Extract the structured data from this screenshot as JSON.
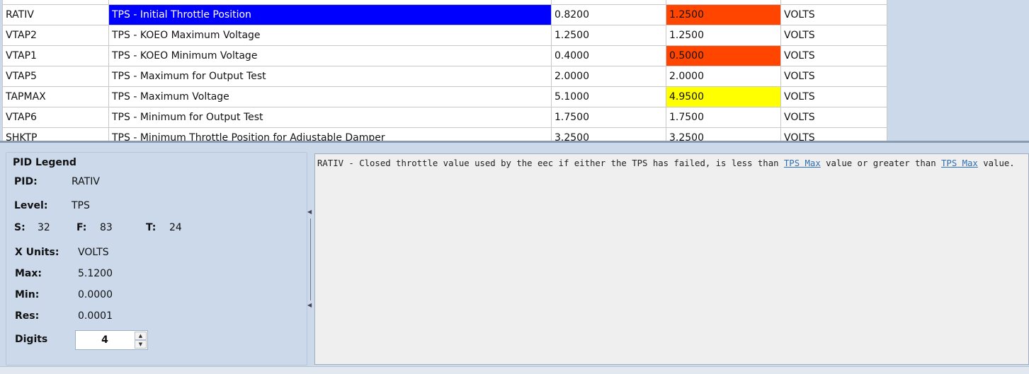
{
  "grid": {
    "rows": [
      {
        "pid": "RATIV",
        "desc": "TPS - Initial Throttle Position",
        "v1": "0.8200",
        "v2": "1.2500",
        "units": "VOLTS",
        "highlight": "orange",
        "selected": true
      },
      {
        "pid": "VTAP2",
        "desc": "TPS - KOEO Maximum Voltage",
        "v1": "1.2500",
        "v2": "1.2500",
        "units": "VOLTS",
        "highlight": "none",
        "selected": false
      },
      {
        "pid": "VTAP1",
        "desc": "TPS - KOEO Minimum Voltage",
        "v1": "0.4000",
        "v2": "0.5000",
        "units": "VOLTS",
        "highlight": "orange",
        "selected": false
      },
      {
        "pid": "VTAP5",
        "desc": "TPS - Maximum for Output Test",
        "v1": "2.0000",
        "v2": "2.0000",
        "units": "VOLTS",
        "highlight": "none",
        "selected": false
      },
      {
        "pid": "TAPMAX",
        "desc": "TPS - Maximum Voltage",
        "v1": "5.1000",
        "v2": "4.9500",
        "units": "VOLTS",
        "highlight": "yellow",
        "selected": false
      },
      {
        "pid": "VTAP6",
        "desc": "TPS - Minimum for Output Test",
        "v1": "1.7500",
        "v2": "1.7500",
        "units": "VOLTS",
        "highlight": "none",
        "selected": false
      },
      {
        "pid": "SHKTP",
        "desc": "TPS - Minimum Throttle Position for Adjustable Damper",
        "v1": "3.2500",
        "v2": "3.2500",
        "units": "VOLTS",
        "highlight": "none",
        "selected": false
      }
    ],
    "colors": {
      "selected": "#0000ff",
      "orange": "#ff4500",
      "yellow": "#ffff00"
    }
  },
  "legend": {
    "title": "PID Legend",
    "pid_label": "PID:",
    "pid_value": "RATIV",
    "level_label": "Level:",
    "level_value": "TPS",
    "s_label": "S:",
    "s_value": "32",
    "f_label": "F:",
    "f_value": "83",
    "t_label": "T:",
    "t_value": "24",
    "xunits_label": "X Units:",
    "xunits_value": "VOLTS",
    "max_label": "Max:",
    "max_value": "5.1200",
    "min_label": "Min:",
    "min_value": "0.0000",
    "res_label": "Res:",
    "res_value": "0.0001",
    "digits_label": "Digits",
    "digits_value": "4"
  },
  "description": {
    "text1": "RATIV - Closed throttle value used by the eec if either the TPS has failed, is less than ",
    "link1": "TPS Max",
    "text2": " value or greater than ",
    "link2": "TPS Max",
    "text3": " value."
  }
}
